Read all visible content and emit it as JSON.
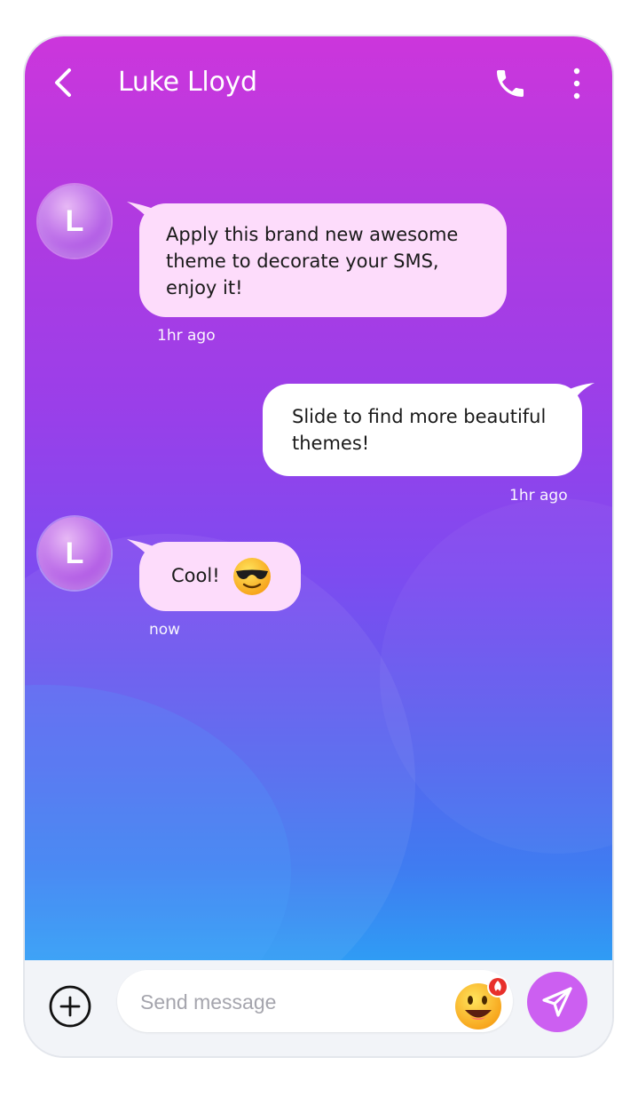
{
  "contact": {
    "name": "Luke Lloyd",
    "initial": "L"
  },
  "messages": [
    {
      "direction": "incoming",
      "text": "Apply this brand new awesome theme to decorate your SMS, enjoy it!",
      "time": "1hr ago"
    },
    {
      "direction": "outgoing",
      "text": "Slide to find more beautiful themes!",
      "time": "1hr ago"
    },
    {
      "direction": "incoming",
      "text": "Cool!",
      "emoji": "sunglasses-emoji",
      "time": "now"
    }
  ],
  "composer": {
    "placeholder": "Send message"
  },
  "icons": {
    "back": "chevron-left-icon",
    "call": "phone-icon",
    "more": "more-vertical-icon",
    "add": "plus-circle-icon",
    "emoji": "smiley-fire-emoji",
    "send": "paper-plane-icon"
  },
  "colors": {
    "gradient_top": "#cc36dc",
    "gradient_mid": "#8a46ee",
    "gradient_bottom": "#2f9cf4",
    "incoming_bubble": "#fddcfb",
    "outgoing_bubble": "#ffffff",
    "send_button": "#cc5ff1"
  }
}
